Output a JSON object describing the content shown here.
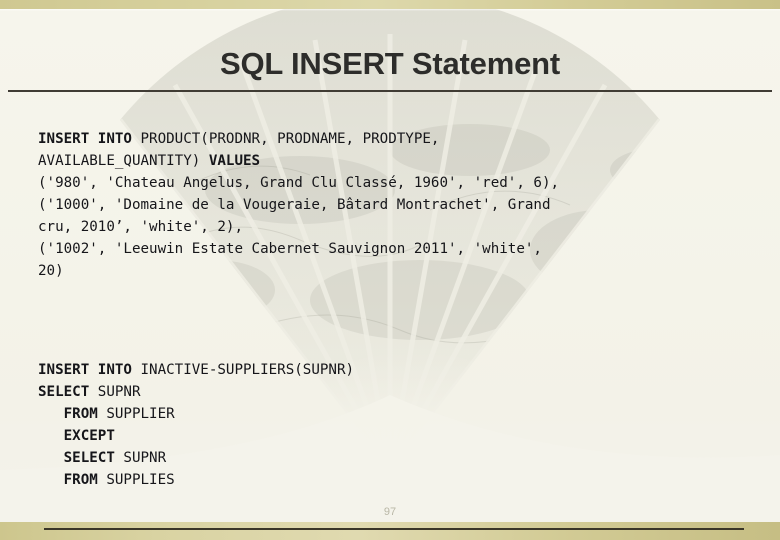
{
  "slide": {
    "title": "SQL INSERT Statement",
    "page_number": "97",
    "colors": {
      "background": "#f4f3ea",
      "band": "#d4cd96",
      "rule": "#403c34",
      "text": "#16161a",
      "page_number": "#b9b7a6"
    }
  },
  "code_blocks": [
    {
      "id": "insert-product",
      "lines": [
        [
          {
            "text": "INSERT INTO ",
            "bold": true
          },
          {
            "text": "PRODUCT(PRODNR, PRODNAME, PRODTYPE,",
            "bold": false
          }
        ],
        [
          {
            "text": "AVAILABLE_QUANTITY) ",
            "bold": false
          },
          {
            "text": "VALUES",
            "bold": true
          }
        ],
        [
          {
            "text": "('980', 'Chateau Angelus, Grand Clu Classé, 1960', 'red', 6),",
            "bold": false
          }
        ],
        [
          {
            "text": "('1000', 'Domaine de la Vougeraie, Bâtard Montrachet', Grand",
            "bold": false
          }
        ],
        [
          {
            "text": "cru, 2010’, 'white', 2),",
            "bold": false
          }
        ],
        [
          {
            "text": "('1002', 'Leeuwin Estate Cabernet Sauvignon 2011', 'white',",
            "bold": false
          }
        ],
        [
          {
            "text": "20)",
            "bold": false
          }
        ]
      ]
    },
    {
      "id": "insert-inactive-suppliers",
      "lines": [
        [
          {
            "text": "INSERT INTO ",
            "bold": true
          },
          {
            "text": "INACTIVE-SUPPLIERS(SUPNR)",
            "bold": false
          }
        ],
        [
          {
            "text": "SELECT ",
            "bold": true
          },
          {
            "text": "SUPNR",
            "bold": false
          }
        ],
        [
          {
            "text": "   FROM ",
            "bold": true
          },
          {
            "text": "SUPPLIER",
            "bold": false
          }
        ],
        [
          {
            "text": "   EXCEPT",
            "bold": true
          }
        ],
        [
          {
            "text": "   SELECT ",
            "bold": true
          },
          {
            "text": "SUPNR",
            "bold": false
          }
        ],
        [
          {
            "text": "   FROM ",
            "bold": true
          },
          {
            "text": "SUPPLIES",
            "bold": false
          }
        ]
      ]
    }
  ]
}
